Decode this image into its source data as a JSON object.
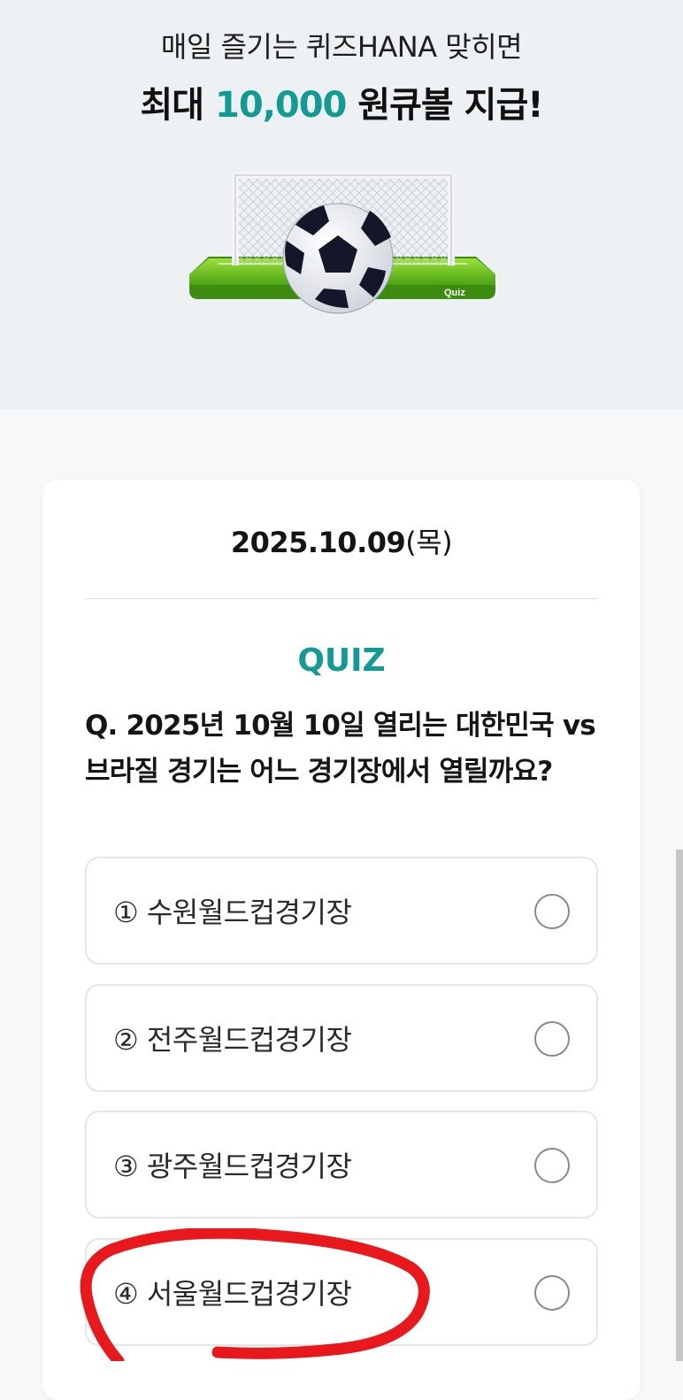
{
  "hero": {
    "subtitle": "매일 즐기는 퀴즈HANA 맞히면",
    "title_prefix": "최대 ",
    "title_amount": "10,000",
    "title_suffix": " 원큐볼 지급!",
    "illustration_label": "Quiz",
    "illustration_icon": "soccer-goal-ball-icon"
  },
  "quiz": {
    "date": "2025.10.09",
    "day_of_week": "(목)",
    "label": "QUIZ",
    "question": "Q. 2025년 10월 10일 열리는 대한민국 vs 브라질 경기는 어느 경기장에서 열릴까요?",
    "options": [
      {
        "label": "① 수원월드컵경기장"
      },
      {
        "label": "② 전주월드컵경기장"
      },
      {
        "label": "③ 광주월드컵경기장"
      },
      {
        "label": "④ 서울월드컵경기장"
      }
    ]
  },
  "colors": {
    "accent": "#129b93",
    "hero_background": "#edf1f4",
    "annotation": "#e8181c"
  }
}
